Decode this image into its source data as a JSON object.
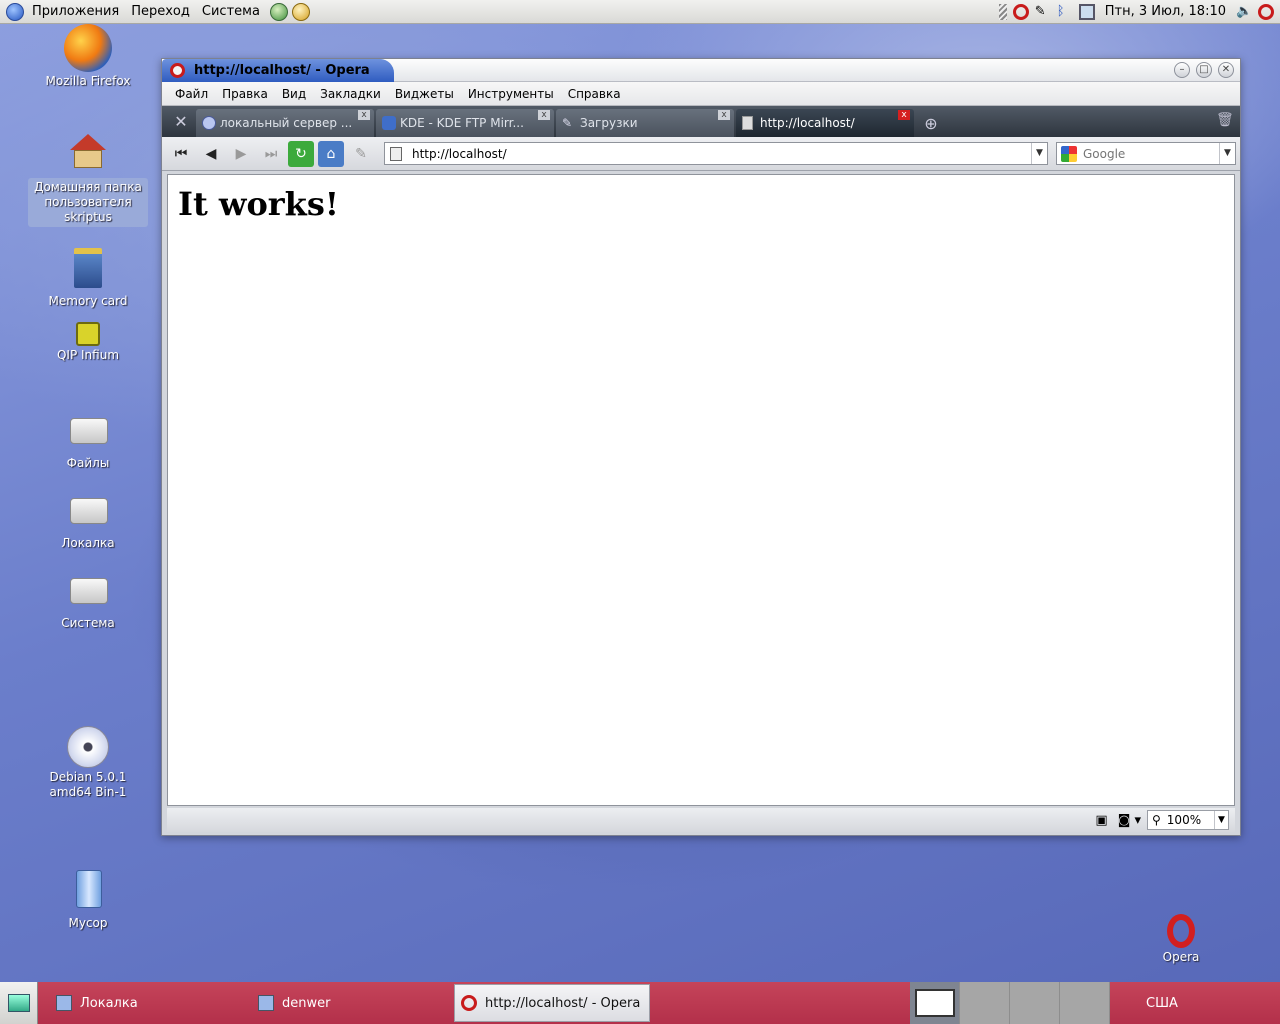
{
  "top_panel": {
    "menus": [
      "Приложения",
      "Переход",
      "Система"
    ],
    "clock": "Птн,  3 Июл, 18:10"
  },
  "desktop_icons": [
    {
      "label": "Mozilla Firefox"
    },
    {
      "label": "Домашняя папка пользователя skriptus"
    },
    {
      "label": "Memory card"
    },
    {
      "label": "QIP Infium"
    },
    {
      "label": "Файлы"
    },
    {
      "label": "Локалка"
    },
    {
      "label": "Система"
    },
    {
      "label": "Debian 5.0.1 amd64 Bin-1"
    },
    {
      "label": "Мусор"
    },
    {
      "label": "Opera"
    }
  ],
  "window": {
    "title": "http://localhost/ - Opera",
    "menu": [
      "Файл",
      "Правка",
      "Вид",
      "Закладки",
      "Виджеты",
      "Инструменты",
      "Справка"
    ],
    "tabs": [
      {
        "label": "локальный сервер ..."
      },
      {
        "label": "KDE - KDE FTP Mirr..."
      },
      {
        "label": "Загрузки"
      },
      {
        "label": "http://localhost/"
      }
    ],
    "close_glyph": "x",
    "address": "http://localhost/",
    "search_placeholder": "Google",
    "page_heading": "It works!",
    "zoom": "100%"
  },
  "taskbar": {
    "tasks": [
      "Локалка",
      "denwer",
      "http://localhost/ - Opera"
    ],
    "keyboard_layout": "США"
  },
  "colors": {
    "opera_red": "#cc1a1a",
    "panel_bottom": "#b3304a",
    "title_blue": "#2f5cc0"
  }
}
